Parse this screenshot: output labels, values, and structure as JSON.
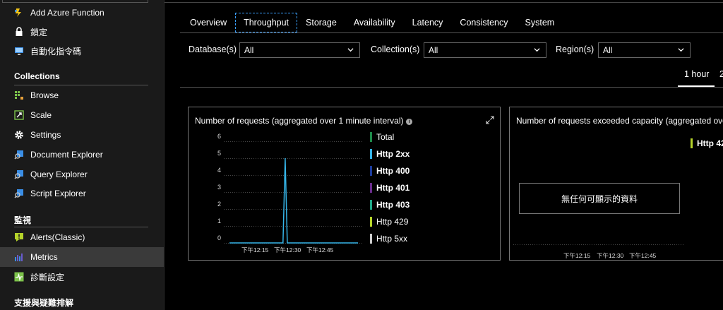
{
  "sidebar": {
    "items_top": [
      {
        "label": "Add Azure Function",
        "icon": "lightning-icon"
      },
      {
        "label": "鎖定",
        "icon": "lock-icon"
      },
      {
        "label": "自動化指令碼",
        "icon": "monitor-icon"
      }
    ],
    "sections": [
      {
        "title": "Collections",
        "items": [
          {
            "label": "Browse",
            "icon": "browse-icon"
          },
          {
            "label": "Scale",
            "icon": "scale-icon"
          },
          {
            "label": "Settings",
            "icon": "gear-icon"
          },
          {
            "label": "Document Explorer",
            "icon": "document-explorer-icon"
          },
          {
            "label": "Query Explorer",
            "icon": "query-explorer-icon"
          },
          {
            "label": "Script Explorer",
            "icon": "script-explorer-icon"
          }
        ]
      },
      {
        "title": "監視",
        "items": [
          {
            "label": "Alerts(Classic)",
            "icon": "alert-icon"
          },
          {
            "label": "Metrics",
            "icon": "metrics-icon"
          },
          {
            "label": "診斷設定",
            "icon": "diagnostics-icon"
          }
        ]
      },
      {
        "title": "支援與疑難排解",
        "items": []
      }
    ]
  },
  "tabs": [
    "Overview",
    "Throughput",
    "Storage",
    "Availability",
    "Latency",
    "Consistency",
    "System"
  ],
  "active_tab": "Throughput",
  "filters": [
    {
      "label": "Database(s)",
      "value": "All"
    },
    {
      "label": "Collection(s)",
      "value": "All"
    },
    {
      "label": "Region(s)",
      "value": "All"
    }
  ],
  "time_range": {
    "selected": "1 hour",
    "next_partial": "2"
  },
  "panel1": {
    "title": "Number of requests (aggregated over 1 minute interval)",
    "info_icon": "info-icon",
    "expand_icon": "expand-icon"
  },
  "panel2": {
    "title": "Number of requests exceeded capacity (aggregated over",
    "no_data": "無任何可顯示的資料",
    "legend": [
      {
        "name": "Http 42",
        "color": "#b5d32a"
      }
    ],
    "x_ticks": [
      "下午12:15",
      "下午12:30",
      "下午12:45"
    ]
  },
  "chart_data": {
    "type": "line",
    "title": "Number of requests (aggregated over 1 minute interval)",
    "y_ticks": [
      6,
      5,
      4,
      3,
      2,
      1,
      0
    ],
    "ylim": [
      0,
      6
    ],
    "x_ticks": [
      "下午12:15",
      "下午12:30",
      "下午12:45"
    ],
    "x_minutes": [
      0,
      5,
      10,
      15,
      20,
      25,
      26,
      27,
      30,
      35,
      40,
      45,
      50,
      55,
      60
    ],
    "series": [
      {
        "name": "Total",
        "color": "#1e8a4a",
        "bold": false,
        "values": null
      },
      {
        "name": "Http 2xx",
        "color": "#35b4e8",
        "bold": true,
        "values": [
          0,
          0,
          0,
          0,
          0,
          0,
          5,
          0,
          0,
          0,
          0,
          0,
          0,
          0,
          0
        ]
      },
      {
        "name": "Http 400",
        "color": "#1c3c9c",
        "bold": true,
        "values": null
      },
      {
        "name": "Http 401",
        "color": "#6a2c8c",
        "bold": true,
        "values": null
      },
      {
        "name": "Http 403",
        "color": "#20a888",
        "bold": true,
        "values": null
      },
      {
        "name": "Http 429",
        "color": "#b5d32a",
        "bold": false,
        "values": null
      },
      {
        "name": "Http 5xx",
        "color": "#cccccc",
        "bold": false,
        "values": null
      }
    ]
  }
}
